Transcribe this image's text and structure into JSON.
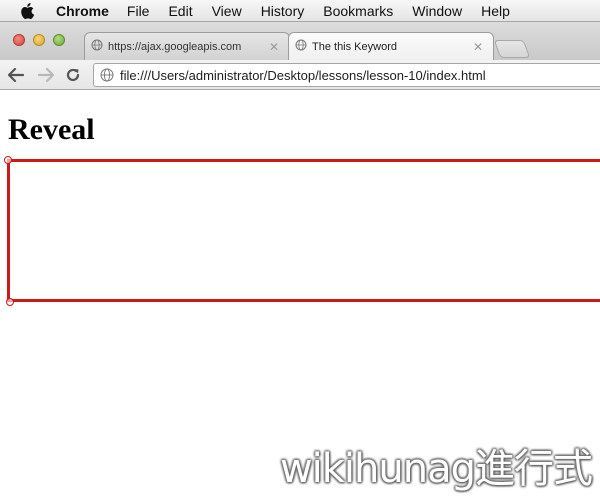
{
  "menubar": {
    "apple_icon": "apple-logo",
    "items": [
      "Chrome",
      "File",
      "Edit",
      "View",
      "History",
      "Bookmarks",
      "Window",
      "Help"
    ]
  },
  "tabs": [
    {
      "title": "https://ajax.googleapis.com",
      "icon": "globe-icon",
      "active": false
    },
    {
      "title": "The this Keyword",
      "icon": "globe-icon",
      "active": true
    }
  ],
  "toolbar": {
    "url": "file:///Users/administrator/Desktop/lessons/lesson-10/index.html",
    "page_icon": "globe-icon"
  },
  "page": {
    "heading": "Reveal",
    "box_border_color": "#d01818"
  },
  "watermark": "wikihunag進行式"
}
